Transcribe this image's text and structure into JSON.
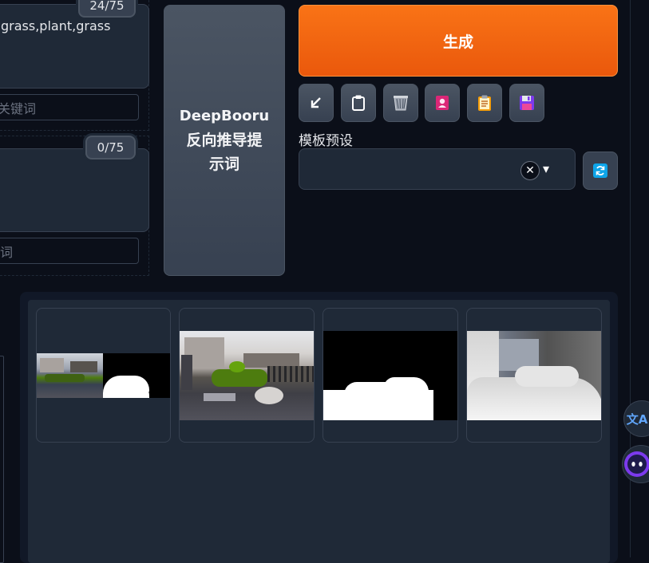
{
  "prompt": {
    "counter": "24/75",
    "text": "grass,plant,grass",
    "keyword_placeholder": "关键词"
  },
  "negative": {
    "counter": "0/75",
    "text": "",
    "keyword_placeholder": "词"
  },
  "deepbooru": {
    "line1": "DeepBooru",
    "line2": "反向推导提",
    "line3": "示词"
  },
  "generate": {
    "label": "生成"
  },
  "toolbar": {
    "icons": [
      "arrow-icon",
      "clipboard-icon",
      "trash-icon",
      "pink-card-icon",
      "notes-icon",
      "save-icon"
    ]
  },
  "style_preset": {
    "label": "模板预设",
    "selected_value": "",
    "clear_symbol": "✕",
    "caret": "▾"
  },
  "gallery": {
    "items": [
      "composite-thumb",
      "garden-render-thumb",
      "mask-thumb",
      "depth-thumb"
    ]
  },
  "floating": {
    "translate_glyph": "文A"
  },
  "colors": {
    "accent": "#f97316",
    "background": "#0b0f19",
    "panel": "#1f2937"
  }
}
